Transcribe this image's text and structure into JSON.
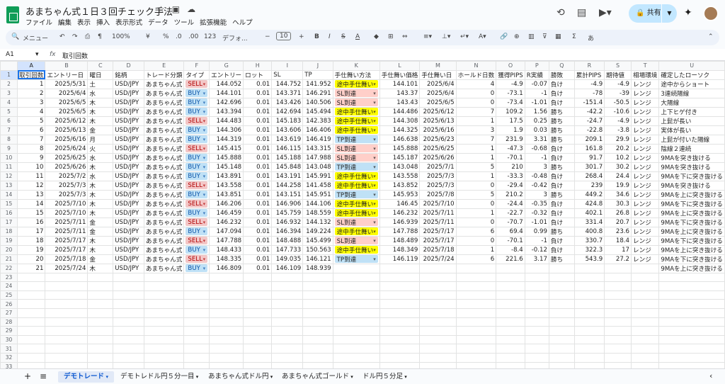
{
  "doc": {
    "title": "あまちゃん式１日３回チェック手法"
  },
  "menu": [
    "ファイル",
    "編集",
    "表示",
    "挿入",
    "表示形式",
    "データ",
    "ツール",
    "拡張機能",
    "ヘルプ"
  ],
  "share": {
    "label": "共有"
  },
  "toolbar": {
    "search": "メニュー",
    "zoom": "100%",
    "currency": "¥",
    "percent": "%",
    "dec1": ".0",
    "dec2": ".00",
    "num": "123",
    "font": "デフォ...",
    "fontsize": "10",
    "bold": "B",
    "italic": "I",
    "strike": "S",
    "textcolor": "A",
    "sigma": "Σ",
    "input": "あ"
  },
  "formula": {
    "cell_ref": "A1",
    "fx": "fx",
    "content": "取引回数"
  },
  "columns": [
    "A",
    "B",
    "C",
    "D",
    "E",
    "F",
    "G",
    "H",
    "I",
    "J",
    "K",
    "L",
    "M",
    "N",
    "O",
    "P",
    "Q",
    "R",
    "S",
    "T",
    "U"
  ],
  "headers": [
    "取引回数",
    "エントリー日",
    "曜日",
    "銘柄",
    "トレード分類",
    "タイプ",
    "エントリー",
    "ロット",
    "SL",
    "TP",
    "手仕舞い方法",
    "手仕舞い価格",
    "手仕舞い日",
    "ホールド日数",
    "獲得PIPS",
    "R実績",
    "勝敗",
    "累計PIPS",
    "期待値",
    "相場環境",
    "確定したローソク"
  ],
  "rows": [
    [
      "1",
      "2025/5/31",
      "土",
      "USD/JPY",
      "あまちゃん式",
      "SELL",
      "144.052",
      "0.01",
      "144.752",
      "141.952",
      "途中手仕舞い",
      "144.101",
      "2025/6/4",
      "4",
      "-4.9",
      "-0.07",
      "負け",
      "-4.9",
      "-4.9",
      "レンジ",
      "途中からショート"
    ],
    [
      "2",
      "2025/6/4",
      "水",
      "USD/JPY",
      "あまちゃん式",
      "BUY",
      "144.101",
      "0.01",
      "143.371",
      "146.291",
      "SL到達",
      "143.37",
      "2025/6/4",
      "0",
      "-73.1",
      "-1",
      "負け",
      "-78",
      "-39",
      "レンジ",
      "3連続陽線"
    ],
    [
      "3",
      "2025/6/5",
      "木",
      "USD/JPY",
      "あまちゃん式",
      "BUY",
      "142.696",
      "0.01",
      "143.426",
      "140.506",
      "SL到達",
      "143.43",
      "2025/6/5",
      "0",
      "-73.4",
      "-1.01",
      "負け",
      "-151.4",
      "-50.5",
      "レンジ",
      "大陽線"
    ],
    [
      "4",
      "2025/6/5",
      "木",
      "USD/JPY",
      "あまちゃん式",
      "BUY",
      "143.394",
      "0.01",
      "142.694",
      "145.494",
      "途中手仕舞い",
      "144.486",
      "2025/6/12",
      "7",
      "109.2",
      "1.56",
      "勝ち",
      "-42.2",
      "-10.6",
      "レンジ",
      "上下ヒゲ付き"
    ],
    [
      "5",
      "2025/6/12",
      "木",
      "USD/JPY",
      "あまちゃん式",
      "SELL",
      "144.483",
      "0.01",
      "145.183",
      "142.383",
      "途中手仕舞い",
      "144.308",
      "2025/6/13",
      "1",
      "17.5",
      "0.25",
      "勝ち",
      "-24.7",
      "-4.9",
      "レンジ",
      "上髭が長い"
    ],
    [
      "6",
      "2025/6/13",
      "金",
      "USD/JPY",
      "あまちゃん式",
      "BUY",
      "144.306",
      "0.01",
      "143.606",
      "146.406",
      "途中手仕舞い",
      "144.325",
      "2025/6/16",
      "3",
      "1.9",
      "0.03",
      "勝ち",
      "-22.8",
      "-3.8",
      "レンジ",
      "実体が長い"
    ],
    [
      "7",
      "2025/6/16",
      "月",
      "USD/JPY",
      "あまちゃん式",
      "BUY",
      "144.319",
      "0.01",
      "143.619",
      "146.419",
      "TP到達",
      "146.638",
      "2025/6/23",
      "7",
      "231.9",
      "3.31",
      "勝ち",
      "209.1",
      "29.9",
      "レンジ",
      "上髭が付いた陽線"
    ],
    [
      "8",
      "2025/6/24",
      "火",
      "USD/JPY",
      "あまちゃん式",
      "SELL",
      "145.415",
      "0.01",
      "146.115",
      "143.315",
      "SL到達",
      "145.888",
      "2025/6/25",
      "1",
      "-47.3",
      "-0.68",
      "負け",
      "161.8",
      "20.2",
      "レンジ",
      "陰線２連続"
    ],
    [
      "9",
      "2025/6/25",
      "水",
      "USD/JPY",
      "あまちゃん式",
      "BUY",
      "145.888",
      "0.01",
      "145.188",
      "147.988",
      "SL到達",
      "145.187",
      "2025/6/26",
      "1",
      "-70.1",
      "-1",
      "負け",
      "91.7",
      "10.2",
      "レンジ",
      "9MAを突き抜ける"
    ],
    [
      "10",
      "2025/6/26",
      "木",
      "USD/JPY",
      "あまちゃん式",
      "BUY",
      "145.148",
      "0.01",
      "145.848",
      "143.048",
      "TP到達",
      "143.048",
      "2025/7/1",
      "5",
      "210",
      "3",
      "勝ち",
      "301.7",
      "30.2",
      "レンジ",
      "9MAを突き抜ける"
    ],
    [
      "11",
      "2025/7/2",
      "水",
      "USD/JPY",
      "あまちゃん式",
      "BUY",
      "143.891",
      "0.01",
      "143.191",
      "145.991",
      "途中手仕舞い",
      "143.558",
      "2025/7/3",
      "1",
      "-33.3",
      "-0.48",
      "負け",
      "268.4",
      "24.4",
      "レンジ",
      "9MAを下に突き抜ける"
    ],
    [
      "12",
      "2025/7/3",
      "木",
      "USD/JPY",
      "あまちゃん式",
      "SELL",
      "143.558",
      "0.01",
      "144.258",
      "141.458",
      "途中手仕舞い",
      "143.852",
      "2025/7/3",
      "0",
      "-29.4",
      "-0.42",
      "負け",
      "239",
      "19.9",
      "レンジ",
      "9MAを突き抜ける"
    ],
    [
      "13",
      "2025/7/3",
      "木",
      "USD/JPY",
      "あまちゃん式",
      "BUY",
      "143.851",
      "0.01",
      "143.151",
      "145.951",
      "TP到達",
      "145.953",
      "2025/7/8",
      "5",
      "210.2",
      "3",
      "勝ち",
      "449.2",
      "34.6",
      "レンジ",
      "9MAを上に突き抜ける"
    ],
    [
      "14",
      "2025/7/10",
      "木",
      "USD/JPY",
      "あまちゃん式",
      "SELL",
      "146.206",
      "0.01",
      "146.906",
      "144.106",
      "途中手仕舞い",
      "146.45",
      "2025/7/10",
      "0",
      "-24.4",
      "-0.35",
      "負け",
      "424.8",
      "30.3",
      "レンジ",
      "9MAを下に突き抜ける"
    ],
    [
      "15",
      "2025/7/10",
      "木",
      "USD/JPY",
      "あまちゃん式",
      "BUY",
      "146.459",
      "0.01",
      "145.759",
      "148.559",
      "途中手仕舞い",
      "146.232",
      "2025/7/11",
      "1",
      "-22.7",
      "-0.32",
      "負け",
      "402.1",
      "26.8",
      "レンジ",
      "9MAを上に突き抜ける"
    ],
    [
      "16",
      "2025/7/11",
      "金",
      "USD/JPY",
      "あまちゃん式",
      "SELL",
      "146.232",
      "0.01",
      "146.932",
      "144.132",
      "SL到達",
      "146.939",
      "2025/7/11",
      "0",
      "-70.7",
      "-1.01",
      "負け",
      "331.4",
      "20.7",
      "レンジ",
      "9MAを下に突き抜ける"
    ],
    [
      "17",
      "2025/7/11",
      "金",
      "USD/JPY",
      "あまちゃん式",
      "BUY",
      "147.094",
      "0.01",
      "146.394",
      "149.224",
      "途中手仕舞い",
      "147.788",
      "2025/7/17",
      "6",
      "69.4",
      "0.99",
      "勝ち",
      "400.8",
      "23.6",
      "レンジ",
      "9MAを上に突き抜ける"
    ],
    [
      "18",
      "2025/7/17",
      "木",
      "USD/JPY",
      "あまちゃん式",
      "SELL",
      "147.788",
      "0.01",
      "148.488",
      "145.499",
      "SL到達",
      "148.489",
      "2025/7/17",
      "0",
      "-70.1",
      "-1",
      "負け",
      "330.7",
      "18.4",
      "レンジ",
      "9MAを下に突き抜ける"
    ],
    [
      "19",
      "2025/7/17",
      "木",
      "USD/JPY",
      "あまちゃん式",
      "BUY",
      "148.433",
      "0.01",
      "147.733",
      "150.563",
      "途中手仕舞い",
      "148.349",
      "2025/7/18",
      "1",
      "-8.4",
      "-0.12",
      "負け",
      "322.3",
      "17",
      "レンジ",
      "9MAを上に突き抜ける"
    ],
    [
      "20",
      "2025/7/18",
      "金",
      "USD/JPY",
      "あまちゃん式",
      "SELL",
      "148.335",
      "0.01",
      "149.035",
      "146.121",
      "TP到達",
      "146.119",
      "2025/7/24",
      "6",
      "221.6",
      "3.17",
      "勝ち",
      "543.9",
      "27.2",
      "レンジ",
      "9MAを下に突き抜ける"
    ],
    [
      "21",
      "2025/7/24",
      "木",
      "USD/JPY",
      "あまちゃん式",
      "BUY",
      "146.809",
      "0.01",
      "146.109",
      "148.939",
      "",
      "",
      "",
      "",
      "",
      "",
      "",
      "",
      "",
      "",
      "9MAを上に突き抜ける"
    ]
  ],
  "sheet_tabs": [
    "デモトレード",
    "デモトレドル円５分一目",
    "あまちゃん式ドル円",
    "あまちゃん式ゴールド",
    "ドル円５分足"
  ]
}
